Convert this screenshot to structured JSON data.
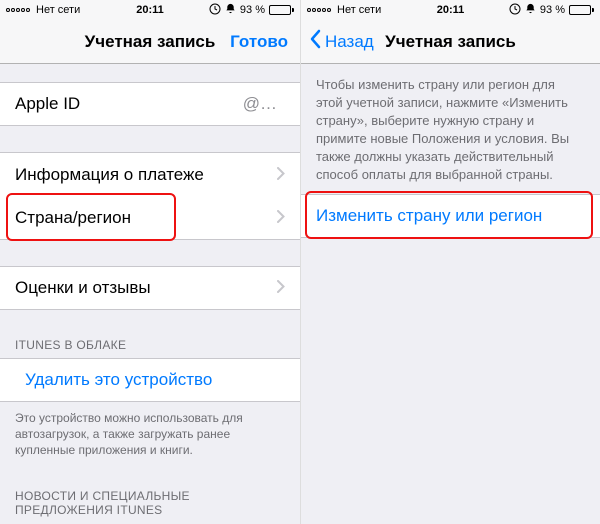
{
  "status": {
    "carrier": "Нет сети",
    "time": "20:11",
    "battery_pct": "93 %",
    "battery_fill": 93
  },
  "left": {
    "nav": {
      "title": "Учетная запись",
      "done": "Готово"
    },
    "rows": {
      "apple_id_label": "Apple ID",
      "apple_id_value": "@…",
      "payment": "Информация о платеже",
      "country": "Страна/регион",
      "reviews": "Оценки и отзывы"
    },
    "cloud_header": "iTUNES В ОБЛАКЕ",
    "remove_device": "Удалить это устройство",
    "foot1": "Это устройство можно использовать для автозагрузок, а также загружать ранее купленные приложения и книги.",
    "foot2": "НОВОСТИ И СПЕЦИАЛЬНЫЕ ПРЕДЛОЖЕНИЯ iTUNES"
  },
  "right": {
    "nav": {
      "back": "Назад",
      "title": "Учетная запись"
    },
    "info": "Чтобы изменить страну или регион для этой учетной записи, нажмите «Изменить страну», выберите нужную страну и примите новые Положения и условия. Вы также должны указать действительный способ оплаты для выбранной страны.",
    "change_country": "Изменить страну или регион"
  }
}
